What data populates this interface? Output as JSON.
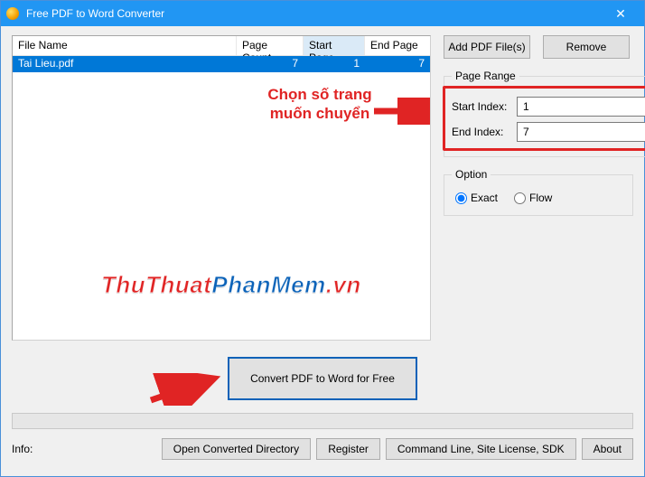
{
  "window": {
    "title": "Free PDF to Word Converter",
    "close_glyph": "✕"
  },
  "grid": {
    "headers": {
      "name": "File Name",
      "count": "Page Count",
      "start": "Start Page",
      "end": "End Page"
    },
    "rows": [
      {
        "name": "Tai Lieu.pdf",
        "count": "7",
        "start": "1",
        "end": "7"
      }
    ]
  },
  "buttons": {
    "add": "Add PDF File(s)",
    "remove": "Remove",
    "convert": "Convert PDF to Word for Free",
    "open_dir": "Open Converted Directory",
    "register": "Register",
    "cmdline": "Command Line, Site License, SDK",
    "about": "About"
  },
  "range": {
    "legend": "Page Range",
    "start_label": "Start Index:",
    "end_label": "End Index:",
    "start_value": "1",
    "end_value": "7"
  },
  "option": {
    "legend": "Option",
    "exact": "Exact",
    "flow": "Flow"
  },
  "footer": {
    "info_label": "Info:"
  },
  "annotations": {
    "range_text": "Chọn số trang muốn chuyển",
    "watermark_left": "ThuThuat",
    "watermark_mid": "PhanMem",
    "watermark_right": ".vn"
  }
}
